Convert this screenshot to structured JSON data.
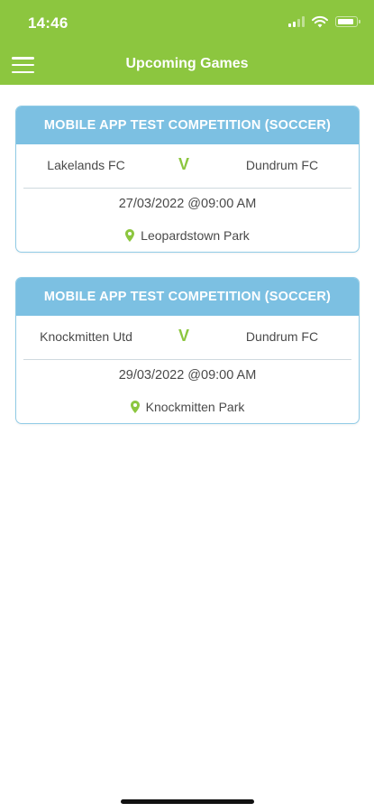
{
  "status_bar": {
    "time": "14:46"
  },
  "header": {
    "title": "Upcoming Games"
  },
  "games": [
    {
      "competition": "MOBILE APP TEST COMPETITION (SOCCER)",
      "home_team": "Lakelands FC",
      "versus": "V",
      "away_team": "Dundrum FC",
      "datetime": "27/03/2022 @09:00 AM",
      "venue": "Leopardstown Park"
    },
    {
      "competition": "MOBILE APP TEST COMPETITION (SOCCER)",
      "home_team": "Knockmitten Utd",
      "versus": "V",
      "away_team": "Dundrum FC",
      "datetime": "29/03/2022 @09:00 AM",
      "venue": "Knockmitten Park"
    }
  ],
  "colors": {
    "header_bg": "#8cc63f",
    "card_header_bg": "#7cc0e2",
    "accent_green": "#8cc63f"
  },
  "icons": [
    "menu-icon",
    "signal-icon",
    "wifi-icon",
    "battery-icon",
    "location-pin-icon"
  ]
}
